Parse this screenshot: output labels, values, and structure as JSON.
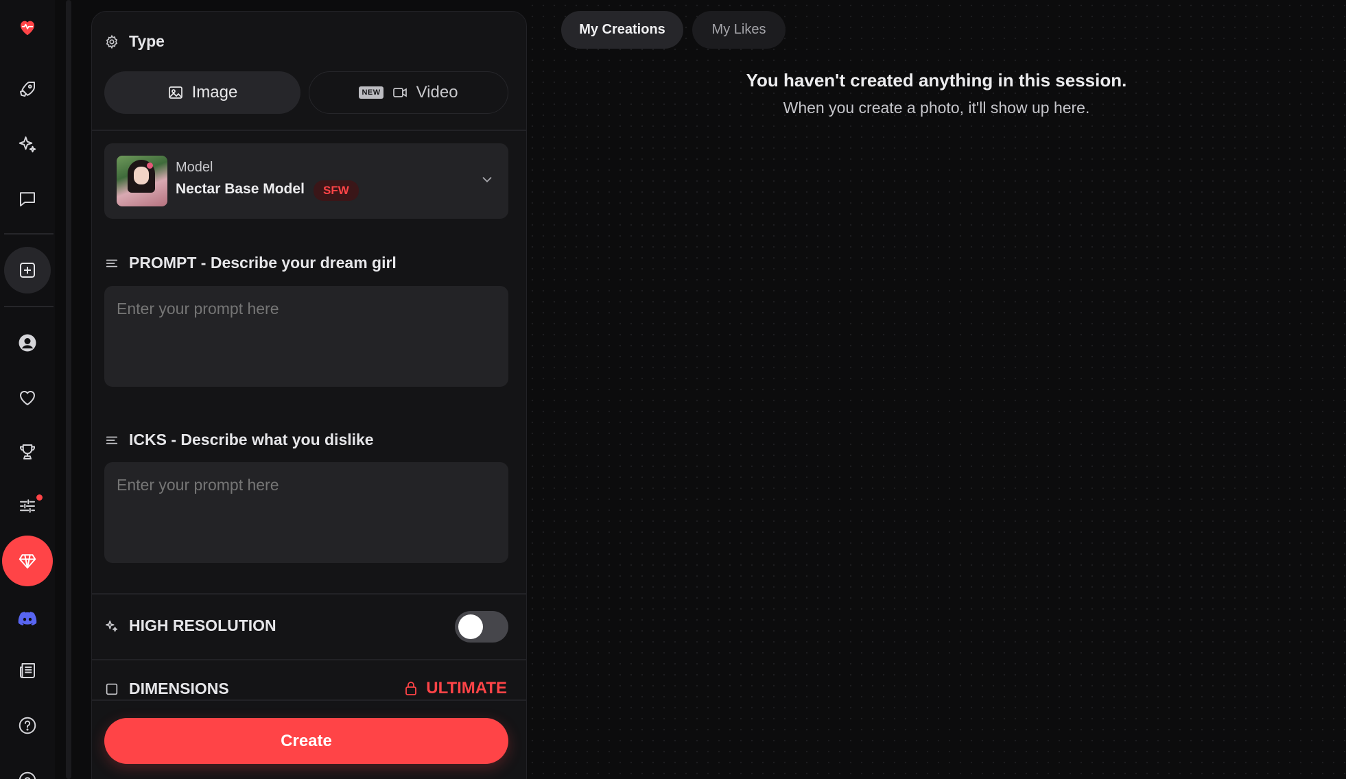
{
  "sidebar": {
    "items": [
      {
        "name": "logo-heart-icon"
      },
      {
        "name": "rocket-icon"
      },
      {
        "name": "sparkles-icon"
      },
      {
        "name": "chat-icon"
      },
      {
        "name": "create-plus-icon"
      },
      {
        "name": "profile-icon"
      },
      {
        "name": "heart-icon"
      },
      {
        "name": "trophy-icon"
      },
      {
        "name": "sliders-icon"
      },
      {
        "name": "diamond-icon"
      },
      {
        "name": "discord-icon"
      },
      {
        "name": "news-icon"
      },
      {
        "name": "help-icon"
      }
    ]
  },
  "panel": {
    "type_title": "Type",
    "type_options": {
      "image": "Image",
      "video": "Video",
      "new_badge": "NEW"
    },
    "model": {
      "label": "Model",
      "name": "Nectar Base Model",
      "badge": "SFW"
    },
    "prompt": {
      "title": "PROMPT - Describe your dream girl",
      "placeholder": "Enter your prompt here"
    },
    "icks": {
      "title": "ICKS - Describe what you dislike",
      "placeholder": "Enter your prompt here"
    },
    "high_resolution": {
      "title": "HIGH RESOLUTION",
      "enabled": false
    },
    "dimensions": {
      "title": "DIMENSIONS",
      "lock_label": "ULTIMATE"
    },
    "create_label": "Create"
  },
  "main": {
    "tabs": [
      {
        "label": "My Creations",
        "active": true
      },
      {
        "label": "My Likes",
        "active": false
      }
    ],
    "empty_title": "You haven't created anything in this session.",
    "empty_subtitle": "When you create a photo, it'll show up here."
  },
  "colors": {
    "accent": "#ff4447",
    "background": "#0c0c0d",
    "panel": "#141416",
    "field": "#232326"
  }
}
